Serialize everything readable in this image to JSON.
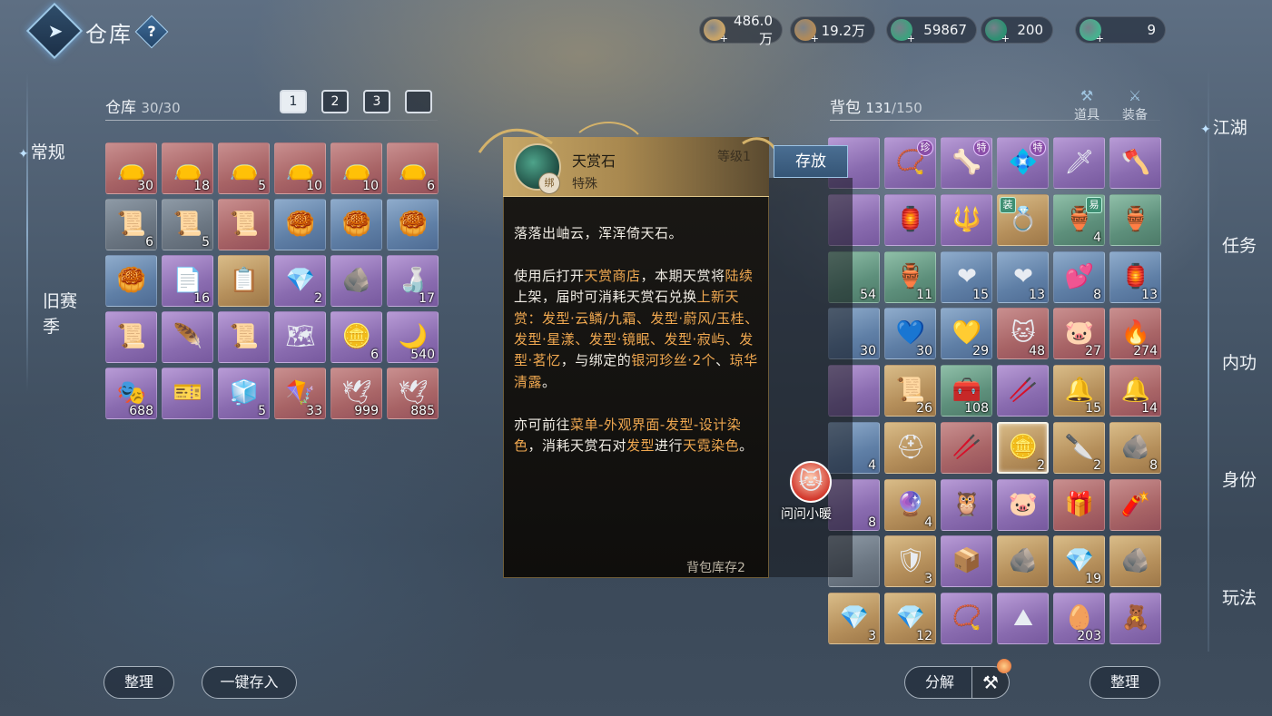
{
  "header": {
    "title": "仓库",
    "help_glyph": "?",
    "currencies": [
      {
        "icon": "scroll-currency-icon",
        "value": "486.0万",
        "color": "#c9a468"
      },
      {
        "icon": "coin-currency-icon",
        "value": "19.2万",
        "color": "#b08a5a"
      },
      {
        "icon": "jade-currency-icon",
        "value": "59867",
        "color": "#3fa07f"
      },
      {
        "icon": "jade-gem-currency-icon",
        "value": "200",
        "color": "#2f8f73"
      },
      {
        "icon": "jade-token-currency-icon",
        "value": "9",
        "color": "#48b08f"
      }
    ]
  },
  "left_nav": {
    "regular": "常规",
    "old_season_1": "旧赛",
    "old_season_2": "季"
  },
  "warehouse": {
    "title": "仓库",
    "capacity": "30/30",
    "tabs": [
      "1",
      "2",
      "3",
      ""
    ],
    "items": [
      {
        "q": "red",
        "art": "👝",
        "count": "30"
      },
      {
        "q": "red",
        "art": "👝",
        "count": "18"
      },
      {
        "q": "red",
        "art": "👝",
        "count": "5"
      },
      {
        "q": "red",
        "art": "👝",
        "count": "10"
      },
      {
        "q": "red",
        "art": "👝",
        "count": "10"
      },
      {
        "q": "red",
        "art": "👝",
        "count": "6"
      },
      {
        "q": "gray",
        "art": "📜",
        "count": "6"
      },
      {
        "q": "gray",
        "art": "📜",
        "count": "5"
      },
      {
        "q": "red",
        "art": "📜",
        "count": ""
      },
      {
        "q": "blue",
        "art": "🥮",
        "count": ""
      },
      {
        "q": "blue",
        "art": "🥮",
        "count": ""
      },
      {
        "q": "blue",
        "art": "🥮",
        "count": ""
      },
      {
        "q": "blue",
        "art": "🥮",
        "count": ""
      },
      {
        "q": "purple",
        "art": "📄",
        "count": "16"
      },
      {
        "q": "gold",
        "art": "📋",
        "count": ""
      },
      {
        "q": "purple",
        "art": "💎",
        "count": "2"
      },
      {
        "q": "purple",
        "art": "🪨",
        "count": ""
      },
      {
        "q": "purple",
        "art": "🍶",
        "count": "17"
      },
      {
        "q": "purple",
        "art": "📜",
        "count": ""
      },
      {
        "q": "purple",
        "art": "🪶",
        "count": ""
      },
      {
        "q": "purple",
        "art": "📜",
        "count": ""
      },
      {
        "q": "purple",
        "art": "🗺",
        "count": ""
      },
      {
        "q": "purple",
        "art": "🪙",
        "count": "6"
      },
      {
        "q": "purple",
        "art": "🌙",
        "count": "540"
      },
      {
        "q": "purple",
        "art": "🎭",
        "count": "688"
      },
      {
        "q": "purple",
        "art": "🎫",
        "count": ""
      },
      {
        "q": "purple",
        "art": "🧊",
        "count": "5"
      },
      {
        "q": "red",
        "art": "🪁",
        "count": "33"
      },
      {
        "q": "red",
        "art": "🕊",
        "count": "999"
      },
      {
        "q": "red",
        "art": "🕊",
        "count": "885"
      }
    ]
  },
  "tooltip": {
    "name": "天赏石",
    "type": "特殊",
    "level": "等级1",
    "bind_mark": "绑",
    "line1": "落落出岫云，浑浑倚天石。",
    "p2": {
      "a": "使用后打开",
      "b": "天赏商店",
      "c": "，本期天赏将",
      "d": "陆续",
      "e": "上架，届时可消耗天赏石兑换",
      "f": "上新天赏：发型·云鳞/九霜、发型·蔚风/玉桂、发型·星漾、发型·镜眠、发型·寂屿、发型·茗忆",
      "g": "，与绑定的",
      "h": "银河珍丝·2个",
      "i": "、",
      "j": "琼华清露",
      "k": "。"
    },
    "p3": {
      "a": "亦可前往",
      "b": "菜单-外观界面-发型-设计染色",
      "c": "，消耗天赏石对",
      "d": "发型",
      "e": "进行",
      "f": "天霓染色",
      "g": "。"
    },
    "stock": "背包库存2",
    "store_button": "存放"
  },
  "helper": {
    "label": "问问小暖",
    "face": "🐱"
  },
  "backpack": {
    "title": "背包",
    "capacity": "131",
    "capacity_max": "/150",
    "sub_tabs": [
      {
        "icon": "tools-icon",
        "label": "道具"
      },
      {
        "icon": "equipment-icon",
        "label": "装备"
      }
    ],
    "items": [
      {
        "q": "purple",
        "art": "",
        "count": ""
      },
      {
        "q": "purple",
        "art": "📿",
        "count": "",
        "tag": "珍"
      },
      {
        "q": "purple",
        "art": "🦴",
        "count": "",
        "tag": "特"
      },
      {
        "q": "purple",
        "art": "💠",
        "count": "",
        "tag": "特"
      },
      {
        "q": "purple",
        "art": "🗡",
        "count": ""
      },
      {
        "q": "purple",
        "art": "🪓",
        "count": ""
      },
      {
        "q": "purple",
        "art": "",
        "count": ""
      },
      {
        "q": "purple",
        "art": "🏮",
        "count": ""
      },
      {
        "q": "purple",
        "art": "🔱",
        "count": ""
      },
      {
        "q": "gold",
        "art": "💍",
        "count": "",
        "tag_left": "装"
      },
      {
        "q": "green",
        "art": "🏺",
        "count": "4",
        "tag_green": "易"
      },
      {
        "q": "green",
        "art": "🏺",
        "count": ""
      },
      {
        "q": "green",
        "art": "",
        "count": "54"
      },
      {
        "q": "green",
        "art": "🏺",
        "count": "11"
      },
      {
        "q": "blue",
        "art": "❤",
        "count": "15"
      },
      {
        "q": "blue",
        "art": "❤",
        "count": "13"
      },
      {
        "q": "blue",
        "art": "💕",
        "count": "8"
      },
      {
        "q": "blue",
        "art": "🏮",
        "count": "13"
      },
      {
        "q": "blue",
        "art": "",
        "count": "30"
      },
      {
        "q": "blue",
        "art": "💙",
        "count": "30"
      },
      {
        "q": "blue",
        "art": "💛",
        "count": "29"
      },
      {
        "q": "red",
        "art": "🐱",
        "count": "48"
      },
      {
        "q": "red",
        "art": "🐷",
        "count": "27"
      },
      {
        "q": "red",
        "art": "🔥",
        "count": "274"
      },
      {
        "q": "purple",
        "art": "",
        "count": ""
      },
      {
        "q": "gold",
        "art": "📜",
        "count": "26"
      },
      {
        "q": "green",
        "art": "🧰",
        "count": "108"
      },
      {
        "q": "purple",
        "art": "🥢",
        "count": ""
      },
      {
        "q": "gold",
        "art": "🔔",
        "count": "15"
      },
      {
        "q": "red",
        "art": "🔔",
        "count": "14"
      },
      {
        "q": "blue",
        "art": "",
        "count": "4"
      },
      {
        "q": "gold",
        "art": "⛑",
        "count": ""
      },
      {
        "q": "red",
        "art": "🥢",
        "count": ""
      },
      {
        "q": "gold",
        "art": "🪙",
        "count": "2",
        "selected": true
      },
      {
        "q": "gold",
        "art": "🔪",
        "count": "2"
      },
      {
        "q": "gold",
        "art": "🪨",
        "count": "8"
      },
      {
        "q": "purple",
        "art": "",
        "count": "8"
      },
      {
        "q": "gold",
        "art": "🔮",
        "count": "4"
      },
      {
        "q": "purple",
        "art": "🦉",
        "count": ""
      },
      {
        "q": "purple",
        "art": "🐷",
        "count": ""
      },
      {
        "q": "red",
        "art": "🎁",
        "count": ""
      },
      {
        "q": "red",
        "art": "🧨",
        "count": ""
      },
      {
        "q": "gray",
        "art": "",
        "count": ""
      },
      {
        "q": "gold",
        "art": "🛡",
        "count": "3"
      },
      {
        "q": "purple",
        "art": "📦",
        "count": ""
      },
      {
        "q": "gold",
        "art": "🪨",
        "count": ""
      },
      {
        "q": "gold",
        "art": "💎",
        "count": "19"
      },
      {
        "q": "gold",
        "art": "🪨",
        "count": ""
      },
      {
        "q": "gold",
        "art": "💎",
        "count": "3"
      },
      {
        "q": "gold",
        "art": "💎",
        "count": "12"
      },
      {
        "q": "purple",
        "art": "📿",
        "count": ""
      },
      {
        "q": "purple",
        "art": "⛰",
        "count": ""
      },
      {
        "q": "purple",
        "art": "🥚",
        "count": "203"
      },
      {
        "q": "purple",
        "art": "🧸",
        "count": ""
      }
    ]
  },
  "right_nav": [
    "江湖",
    "任务",
    "内功",
    "身份",
    "玩法"
  ],
  "buttons": {
    "sort_left": "整理",
    "deposit_all": "一键存入",
    "decompose": "分解",
    "sort_right": "整理"
  }
}
